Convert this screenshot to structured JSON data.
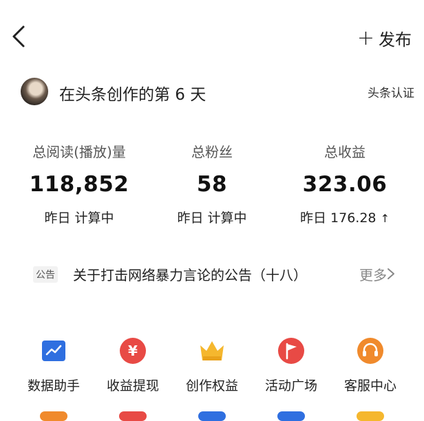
{
  "header": {
    "publish_plus": "+",
    "publish_label": "发布"
  },
  "profile": {
    "creator_text": "在头条创作的第 6 天",
    "cert_label": "头条认证"
  },
  "stats": [
    {
      "label": "总阅读(播放)量",
      "value": "118,852",
      "sub": "昨日 计算中"
    },
    {
      "label": "总粉丝",
      "value": "58",
      "sub": "昨日 计算中"
    },
    {
      "label": "总收益",
      "value": "323.06",
      "sub": "昨日 176.28",
      "sub_arrow": "↑"
    }
  ],
  "notice": {
    "tag": "公告",
    "text": "关于打击网络暴力言论的公告（十八）",
    "more": "更多"
  },
  "tools": [
    {
      "label": "数据助手",
      "icon": "data-chart-icon",
      "color": "#2f6fe0"
    },
    {
      "label": "收益提现",
      "icon": "yuan-coin-icon",
      "color": "#e84a45"
    },
    {
      "label": "创作权益",
      "icon": "crown-icon",
      "color": "#f5b72e"
    },
    {
      "label": "活动广场",
      "icon": "flag-icon",
      "color": "#e84a45"
    },
    {
      "label": "客服中心",
      "icon": "headset-icon",
      "color": "#f08a2c"
    }
  ],
  "colors": {
    "accent_blue": "#2f6fe0",
    "accent_red": "#e84a45",
    "accent_gold": "#f5b72e",
    "accent_orange": "#f08a2c"
  }
}
